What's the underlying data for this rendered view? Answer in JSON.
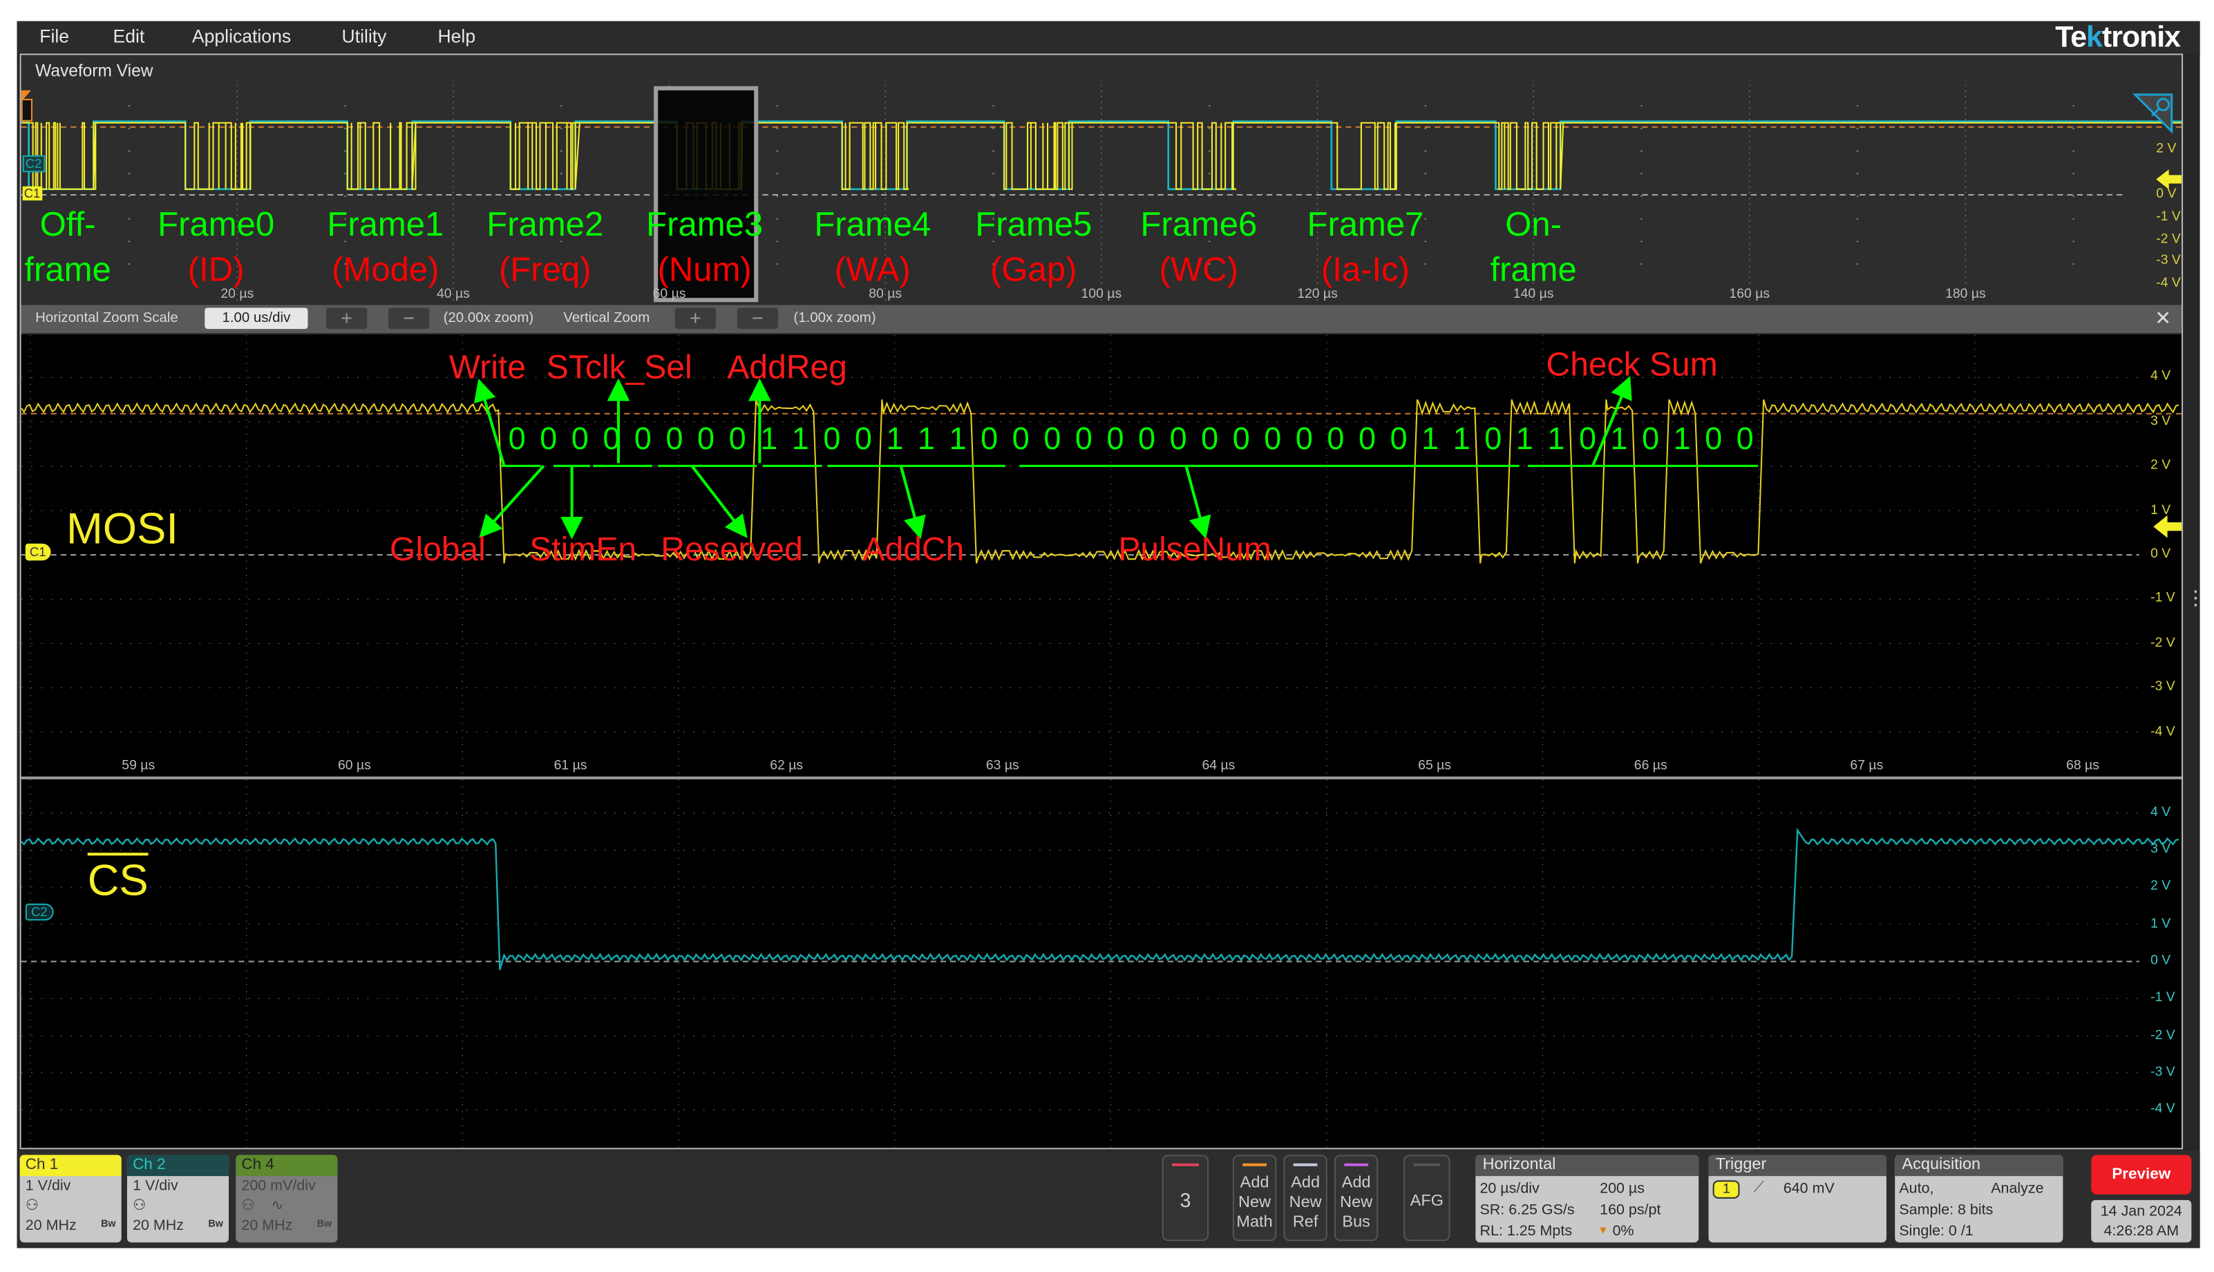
{
  "menu": [
    "File",
    "Edit",
    "Applications",
    "Utility",
    "Help"
  ],
  "brand": {
    "pre": "Te",
    "k": "k",
    "post": "tronix"
  },
  "view_title": "Waveform View",
  "overview": {
    "frames": [
      {
        "name": "Off-",
        "sub": "frame",
        "sub_green": true
      },
      {
        "name": "Frame0",
        "sub": "(ID)"
      },
      {
        "name": "Frame1",
        "sub": "(Mode)"
      },
      {
        "name": "Frame2",
        "sub": "(Freq)"
      },
      {
        "name": "Frame3",
        "sub": "(Num)"
      },
      {
        "name": "Frame4",
        "sub": "(WA)"
      },
      {
        "name": "Frame5",
        "sub": "(Gap)"
      },
      {
        "name": "Frame6",
        "sub": "(WC)"
      },
      {
        "name": "Frame7",
        "sub": "(Ia-Ic)"
      },
      {
        "name": "On-",
        "sub": "frame",
        "sub_green": true
      }
    ],
    "time_ticks": [
      "20 µs",
      "40 µs",
      "60 µs",
      "80 µs",
      "100 µs",
      "120 µs",
      "140 µs",
      "160 µs",
      "180 µs"
    ],
    "volt_ticks": [
      "2 V",
      "0 V",
      "-1 V",
      "-2 V",
      "-3 V",
      "-4 V"
    ],
    "ch_tags": [
      "C2",
      "C1"
    ]
  },
  "zoom_bar": {
    "h_label": "Horizontal Zoom Scale",
    "h_value": "1.00 us/div",
    "plus": "+",
    "minus": "−",
    "h_zoom": "(20.00x zoom)",
    "v_label": "Vertical Zoom",
    "v_zoom": "(1.00x zoom)",
    "close": "✕"
  },
  "mosi": {
    "label": "MOSI",
    "tag": "C1",
    "bits": "0000000011001110000000000000011011010100",
    "top_annotations": [
      "Write",
      "STclk_Sel",
      "AddReg",
      "Check Sum"
    ],
    "bottom_annotations": [
      "Global",
      "StimEn",
      "Reserved",
      "AddCh",
      "PulseNum"
    ],
    "time_ticks": [
      "59 µs",
      "60 µs",
      "61 µs",
      "62 µs",
      "63 µs",
      "64 µs",
      "65 µs",
      "66 µs",
      "67 µs",
      "68 µs"
    ],
    "volt_ticks": [
      "4 V",
      "3 V",
      "2 V",
      "1 V",
      "0 V",
      "-1 V",
      "-2 V",
      "-3 V",
      "-4 V"
    ]
  },
  "cs": {
    "label": "CS",
    "tag": "C2",
    "volt_ticks": [
      "4 V",
      "3 V",
      "2 V",
      "1 V",
      "0 V",
      "-1 V",
      "-2 V",
      "-3 V",
      "-4 V"
    ]
  },
  "channels": [
    {
      "label": "Ch 1",
      "scale": "1 V/div",
      "bw": "20 MHz",
      "bw_icon": "Bw"
    },
    {
      "label": "Ch 2",
      "scale": "1 V/div",
      "bw": "20 MHz",
      "bw_icon": "Bw"
    },
    {
      "label": "Ch 4",
      "scale": "200 mV/div",
      "bw": "20 MHz",
      "bw_icon": "Bw"
    }
  ],
  "buttons": {
    "three": "3",
    "math": [
      "Add",
      "New",
      "Math"
    ],
    "ref": [
      "Add",
      "New",
      "Ref"
    ],
    "bus": [
      "Add",
      "New",
      "Bus"
    ],
    "afg": "AFG"
  },
  "horizontal": {
    "title": "Horizontal",
    "scale": "20 µs/div",
    "duration": "200 µs",
    "sr": "SR: 6.25 GS/s",
    "res": "160 ps/pt",
    "rl": "RL: 1.25 Mpts",
    "pos": "0%"
  },
  "trigger": {
    "title": "Trigger",
    "source": "1",
    "level": "640 mV"
  },
  "acquisition": {
    "title": "Acquisition",
    "mode": "Auto,",
    "analyze": "Analyze",
    "sample": "Sample: 8 bits",
    "single": "Single: 0 /1"
  },
  "preview": "Preview",
  "datetime": {
    "date": "14 Jan 2024",
    "time": "4:26:28 AM"
  },
  "colors": {
    "ch1": "#f5ee2a",
    "ch2": "#17a8b0",
    "ch4": "#5e8a2e",
    "annotation_red": "#ff1a1a",
    "annotation_green": "#00ff00",
    "preview": "#ee1c25"
  }
}
